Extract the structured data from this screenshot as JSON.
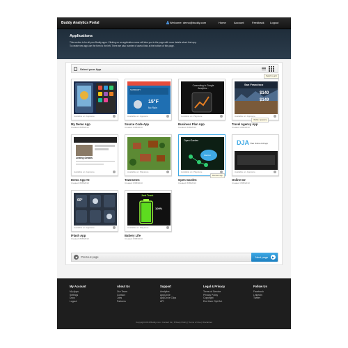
{
  "nav": {
    "brand": "Buddy Analytics Portal",
    "welcome": "Welcome: demo@buddy.com",
    "links": [
      "Home",
      "Account",
      "Feedback",
      "Logout"
    ]
  },
  "header": {
    "title": "Applications",
    "line1": "This section is for all your Buddy apps. Clicking on an application name will take you to the page with more details about that app.",
    "line2": "To create new app use the form to the left. There are also number of useful links at the bottom of this page."
  },
  "select_bar": {
    "label": "Select your App",
    "tooltip": "Switch to grid"
  },
  "apps": [
    {
      "name": "My Demo App",
      "created": "Created: 8/05/2013",
      "availability": "Available on: Appstore",
      "platform": "apple"
    },
    {
      "name": "Source Code App",
      "created": "Created: 8/05/2013",
      "availability": "Available on: Appstore",
      "platform": "apple",
      "shot_text": [
        "SUMMARY",
        "15°F",
        "No Rain"
      ]
    },
    {
      "name": "Business Plan App",
      "created": "Created: 8/05/2013",
      "availability": "Available on: Playstore",
      "platform": "android",
      "shot_text": [
        "Connecting to Google Analytics..."
      ]
    },
    {
      "name": "Travel Agency App",
      "created": "Created: 8/05/2013",
      "availability": "Available on: Appstore",
      "platform": "apple",
      "shot_text": [
        "San Francisco",
        "$140",
        "$149"
      ],
      "tooltip": "Visible: Appstore"
    },
    {
      "name": "Demo App #2",
      "created": "Created: 8/05/2013",
      "availability": "Available on: Appstore",
      "platform": "apple",
      "shot_text": [
        "Listing Details"
      ]
    },
    {
      "name": "Townsmen",
      "created": "Created: 8/05/2013",
      "availability": "Available on: Playstore",
      "platform": "android"
    },
    {
      "name": "Open Garden",
      "created": "Created: 8/05/2013",
      "availability": "Available on: Playstore",
      "platform": "android",
      "shot_text": [
        "Open Garden",
        "Internet"
      ],
      "tooltip": "Remove app"
    },
    {
      "name": "Online DJ",
      "created": "Created: 8/05/2013",
      "availability": "Available on: Appstore",
      "platform": "apple",
      "shot_text": [
        "DJA",
        "That Online DJ App"
      ]
    },
    {
      "name": "iFlash App",
      "created": "Created: 8/05/2013",
      "availability": "Available on: Appstore",
      "platform": "apple",
      "shot_text": [
        "60°"
      ]
    },
    {
      "name": "Battery Life",
      "created": "Created: 8/05/2013",
      "availability": "Available on: Playstore",
      "platform": "android",
      "shot_text": [
        "Just Track",
        "100%"
      ]
    }
  ],
  "pager": {
    "prev": "Previous page",
    "next": "Next page"
  },
  "footer": {
    "columns": [
      {
        "title": "My Account",
        "links": [
          "My Apps",
          "Settings",
          "Docs",
          "Logout"
        ]
      },
      {
        "title": "About Us",
        "links": [
          "Our Team",
          "Contact",
          "Jobs",
          "Partners"
        ]
      },
      {
        "title": "Support",
        "links": [
          "Analytics",
          "AppCircle",
          "AppCircle Clips",
          "API"
        ]
      },
      {
        "title": "Legal & Privacy",
        "links": [
          "Terms of Service",
          "Privacy Policy",
          "Copyright",
          "End User Opt-Out"
        ]
      },
      {
        "title": "Follow Us",
        "links": [
          "Facebook",
          "LinkedIn",
          "Twitter"
        ]
      }
    ],
    "copyright": "Copyright 2013 Buddy.com. Contact Us | Privacy Policy | Terms of Use | Disclaimer"
  },
  "colors": {
    "accent": "#1b7fc0",
    "nav_bg": "#1a1a1a",
    "header_bg": "#243443",
    "footer_bg": "#1e1e1e"
  }
}
